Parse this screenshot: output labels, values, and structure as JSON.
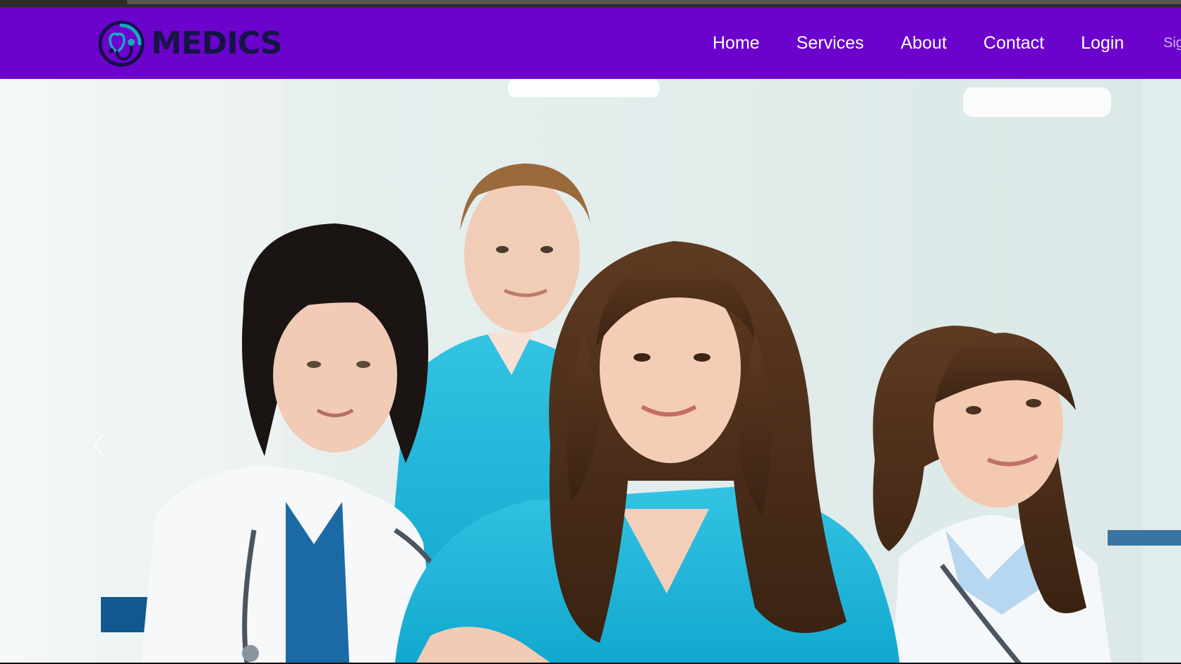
{
  "brand": {
    "name": "MEDICS",
    "logo_icon": "stethoscope-heart-icon"
  },
  "nav": {
    "items": [
      {
        "label": "Home"
      },
      {
        "label": "Services"
      },
      {
        "label": "About"
      },
      {
        "label": "Contact"
      },
      {
        "label": "Login"
      }
    ],
    "signup_label": "Sig"
  },
  "hero": {
    "image": "medical-team-photo",
    "prev_icon": "chevron-left-icon"
  },
  "colors": {
    "navbar": "#6b03cc",
    "brand_text": "#161446",
    "logo_teal": "#19a6c6",
    "nav_text": "#ffffff"
  }
}
